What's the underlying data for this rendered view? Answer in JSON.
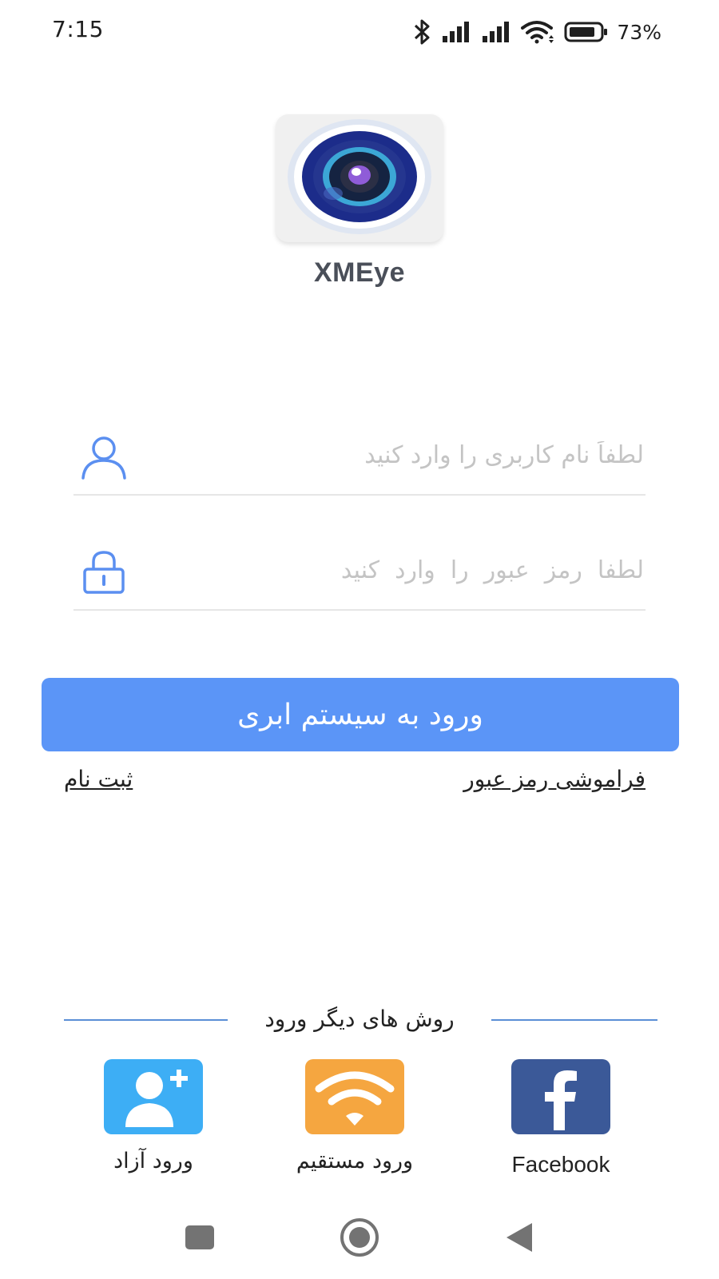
{
  "status_bar": {
    "time": "7:15",
    "battery": "73%",
    "icons": [
      "bluetooth-icon",
      "signal-icon",
      "signal-icon",
      "wifi-icon",
      "battery-icon"
    ]
  },
  "app": {
    "name": "XMEye",
    "logo_icon": "camera-lens-icon"
  },
  "login": {
    "username_placeholder": "لطفاً نام کاربری را وارد کنید",
    "password_placeholder": "لطفا  رمز  عبور  را  وارد  کنید",
    "submit_label": "ورود به سیستم ابری",
    "forgot_label": "فراموشی رمز عبور",
    "register_label": "ثبت نام"
  },
  "other_methods": {
    "title": "روش های دیگر ورود",
    "items": [
      {
        "label": "ورود آزاد",
        "icon": "add-user-icon",
        "color": "#3daef5"
      },
      {
        "label": "ورود مستقیم",
        "icon": "wifi-icon",
        "color": "#f5a640"
      },
      {
        "label": "Facebook",
        "icon": "facebook-icon",
        "color": "#3b5998"
      }
    ]
  },
  "colors": {
    "accent": "#5b95f7",
    "input_icon": "#5b8ff0",
    "divider": "#5b8fd6"
  },
  "nav": [
    "recents-icon",
    "home-icon",
    "back-icon"
  ]
}
